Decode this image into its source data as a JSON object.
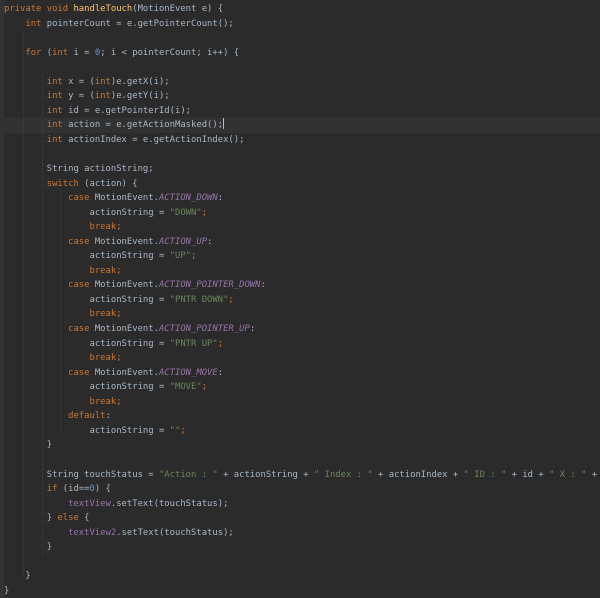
{
  "editor": {
    "lines": [
      [
        {
          "t": "private void ",
          "c": "kw"
        },
        {
          "t": "handleTouch",
          "c": "fn"
        },
        {
          "t": "(MotionEvent e) {",
          "c": "plain"
        }
      ],
      [
        {
          "t": "    ",
          "c": "plain"
        },
        {
          "t": "int ",
          "c": "kw"
        },
        {
          "t": "pointerCount = e.getPointerCount();",
          "c": "plain"
        }
      ],
      [],
      [
        {
          "t": "    ",
          "c": "plain"
        },
        {
          "t": "for ",
          "c": "kw"
        },
        {
          "t": "(",
          "c": "plain"
        },
        {
          "t": "int ",
          "c": "kw"
        },
        {
          "t": "i = ",
          "c": "plain"
        },
        {
          "t": "0",
          "c": "num"
        },
        {
          "t": "; i < pointerCount; i++) {",
          "c": "plain"
        }
      ],
      [],
      [
        {
          "t": "        ",
          "c": "plain"
        },
        {
          "t": "int ",
          "c": "kw"
        },
        {
          "t": "x = (",
          "c": "plain"
        },
        {
          "t": "int",
          "c": "kw"
        },
        {
          "t": ")e.getX(i);",
          "c": "plain"
        }
      ],
      [
        {
          "t": "        ",
          "c": "plain"
        },
        {
          "t": "int ",
          "c": "kw"
        },
        {
          "t": "y = (",
          "c": "plain"
        },
        {
          "t": "int",
          "c": "kw"
        },
        {
          "t": ")e.getY(i);",
          "c": "plain"
        }
      ],
      [
        {
          "t": "        ",
          "c": "plain"
        },
        {
          "t": "int ",
          "c": "kw"
        },
        {
          "t": "id = e.getPointerId(i);",
          "c": "plain"
        }
      ],
      [
        {
          "t": "        ",
          "c": "plain"
        },
        {
          "t": "int ",
          "c": "kw"
        },
        {
          "t": "action = e.getActionMasked();",
          "c": "plain"
        }
      ],
      [
        {
          "t": "        ",
          "c": "plain"
        },
        {
          "t": "int ",
          "c": "kw"
        },
        {
          "t": "actionIndex = e.getActionIndex();",
          "c": "plain"
        }
      ],
      [],
      [
        {
          "t": "        String actionString;",
          "c": "plain"
        }
      ],
      [
        {
          "t": "        ",
          "c": "plain"
        },
        {
          "t": "switch ",
          "c": "kw"
        },
        {
          "t": "(action) {",
          "c": "plain"
        }
      ],
      [
        {
          "t": "            ",
          "c": "plain"
        },
        {
          "t": "case ",
          "c": "kw"
        },
        {
          "t": "MotionEvent.",
          "c": "plain"
        },
        {
          "t": "ACTION_DOWN",
          "c": "const"
        },
        {
          "t": ":",
          "c": "plain"
        }
      ],
      [
        {
          "t": "                actionString = ",
          "c": "plain"
        },
        {
          "t": "\"DOWN\"",
          "c": "str"
        },
        {
          "t": ";",
          "c": "kw"
        }
      ],
      [
        {
          "t": "                ",
          "c": "plain"
        },
        {
          "t": "break;",
          "c": "kw"
        }
      ],
      [
        {
          "t": "            ",
          "c": "plain"
        },
        {
          "t": "case ",
          "c": "kw"
        },
        {
          "t": "MotionEvent.",
          "c": "plain"
        },
        {
          "t": "ACTION_UP",
          "c": "const"
        },
        {
          "t": ":",
          "c": "plain"
        }
      ],
      [
        {
          "t": "                actionString = ",
          "c": "plain"
        },
        {
          "t": "\"UP\"",
          "c": "str"
        },
        {
          "t": ";",
          "c": "kw"
        }
      ],
      [
        {
          "t": "                ",
          "c": "plain"
        },
        {
          "t": "break;",
          "c": "kw"
        }
      ],
      [
        {
          "t": "            ",
          "c": "plain"
        },
        {
          "t": "case ",
          "c": "kw"
        },
        {
          "t": "MotionEvent.",
          "c": "plain"
        },
        {
          "t": "ACTION_POINTER_DOWN",
          "c": "const"
        },
        {
          "t": ":",
          "c": "plain"
        }
      ],
      [
        {
          "t": "                actionString = ",
          "c": "plain"
        },
        {
          "t": "\"PNTR DOWN\"",
          "c": "str"
        },
        {
          "t": ";",
          "c": "kw"
        }
      ],
      [
        {
          "t": "                ",
          "c": "plain"
        },
        {
          "t": "break;",
          "c": "kw"
        }
      ],
      [
        {
          "t": "            ",
          "c": "plain"
        },
        {
          "t": "case ",
          "c": "kw"
        },
        {
          "t": "MotionEvent.",
          "c": "plain"
        },
        {
          "t": "ACTION_POINTER_UP",
          "c": "const"
        },
        {
          "t": ":",
          "c": "plain"
        }
      ],
      [
        {
          "t": "                actionString = ",
          "c": "plain"
        },
        {
          "t": "\"PNTR UP\"",
          "c": "str"
        },
        {
          "t": ";",
          "c": "kw"
        }
      ],
      [
        {
          "t": "                ",
          "c": "plain"
        },
        {
          "t": "break;",
          "c": "kw"
        }
      ],
      [
        {
          "t": "            ",
          "c": "plain"
        },
        {
          "t": "case ",
          "c": "kw"
        },
        {
          "t": "MotionEvent.",
          "c": "plain"
        },
        {
          "t": "ACTION_MOVE",
          "c": "const"
        },
        {
          "t": ":",
          "c": "plain"
        }
      ],
      [
        {
          "t": "                actionString = ",
          "c": "plain"
        },
        {
          "t": "\"MOVE\"",
          "c": "str"
        },
        {
          "t": ";",
          "c": "kw"
        }
      ],
      [
        {
          "t": "                ",
          "c": "plain"
        },
        {
          "t": "break;",
          "c": "kw"
        }
      ],
      [
        {
          "t": "            ",
          "c": "plain"
        },
        {
          "t": "default",
          "c": "kw"
        },
        {
          "t": ":",
          "c": "plain"
        }
      ],
      [
        {
          "t": "                actionString = ",
          "c": "plain"
        },
        {
          "t": "\"\"",
          "c": "str"
        },
        {
          "t": ";",
          "c": "kw"
        }
      ],
      [
        {
          "t": "        }",
          "c": "plain"
        }
      ],
      [],
      [
        {
          "t": "        String touchStatus = ",
          "c": "plain"
        },
        {
          "t": "\"Action : \"",
          "c": "str"
        },
        {
          "t": " + actionString + ",
          "c": "plain"
        },
        {
          "t": "\" Index : \"",
          "c": "str"
        },
        {
          "t": " + actionIndex + ",
          "c": "plain"
        },
        {
          "t": "\" ID : \"",
          "c": "str"
        },
        {
          "t": " + id + ",
          "c": "plain"
        },
        {
          "t": "\" X : \"",
          "c": "str"
        },
        {
          "t": " + x + ",
          "c": "plain"
        },
        {
          "t": "\" Y : \"",
          "c": "str"
        },
        {
          "t": " + y;",
          "c": "plain"
        }
      ],
      [
        {
          "t": "        ",
          "c": "plain"
        },
        {
          "t": "if ",
          "c": "kw"
        },
        {
          "t": "(id==",
          "c": "plain"
        },
        {
          "t": "0",
          "c": "num"
        },
        {
          "t": ") {",
          "c": "plain"
        }
      ],
      [
        {
          "t": "            ",
          "c": "plain"
        },
        {
          "t": "textView",
          "c": "field"
        },
        {
          "t": ".setText(touchStatus);",
          "c": "plain"
        }
      ],
      [
        {
          "t": "        } ",
          "c": "plain"
        },
        {
          "t": "else ",
          "c": "kw"
        },
        {
          "t": "{",
          "c": "plain"
        }
      ],
      [
        {
          "t": "            ",
          "c": "plain"
        },
        {
          "t": "textView2",
          "c": "field"
        },
        {
          "t": ".setText(touchStatus);",
          "c": "plain"
        }
      ],
      [
        {
          "t": "        }",
          "c": "plain"
        }
      ],
      [],
      [
        {
          "t": "    }",
          "c": "plain"
        }
      ],
      [
        {
          "t": "}",
          "c": "plain"
        }
      ]
    ]
  }
}
